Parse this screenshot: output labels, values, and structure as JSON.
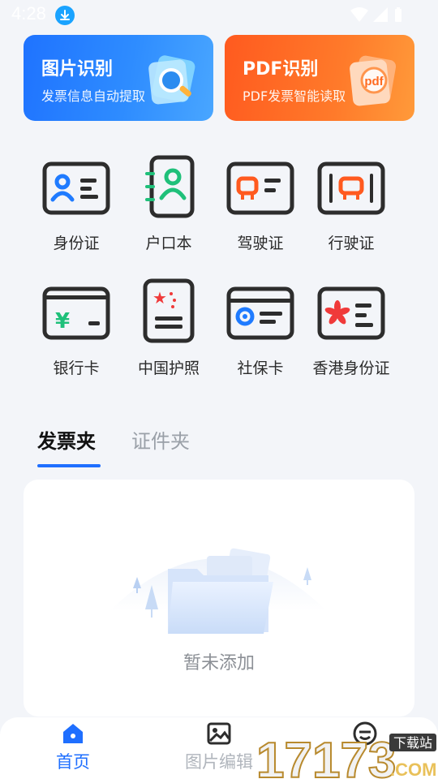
{
  "status": {
    "time": "4:28"
  },
  "banners": {
    "image": {
      "title": "图片识别",
      "subtitle": "发票信息自动提取",
      "color": "#1f73ff"
    },
    "pdf": {
      "title": "PDF识别",
      "subtitle": "PDF发票智能读取",
      "color": "#ff5a1f",
      "art_text": "pdf"
    }
  },
  "grid": {
    "items": [
      {
        "label": "身份证",
        "icon": "id-card-icon"
      },
      {
        "label": "户口本",
        "icon": "household-register-icon"
      },
      {
        "label": "驾驶证",
        "icon": "driver-license-icon"
      },
      {
        "label": "行驶证",
        "icon": "vehicle-license-icon"
      },
      {
        "label": "银行卡",
        "icon": "bank-card-icon"
      },
      {
        "label": "中国护照",
        "icon": "passport-icon"
      },
      {
        "label": "社保卡",
        "icon": "social-security-card-icon"
      },
      {
        "label": "香港身份证",
        "icon": "hk-id-card-icon"
      }
    ]
  },
  "tabs": {
    "active": "发票夹",
    "inactive": "证件夹"
  },
  "empty": {
    "text": "暂未添加"
  },
  "nav": {
    "home": "首页",
    "edit": "图片编辑"
  },
  "watermark": {
    "text": "17173",
    "badge": "下载站",
    "suffix": ".COM"
  },
  "colors": {
    "accent": "#1f6fff",
    "icon_blue": "#1f7bff",
    "icon_green": "#1fc07a",
    "icon_orange": "#ff5a1f",
    "icon_red": "#f03a3a",
    "icon_dark": "#2d2d2d"
  }
}
